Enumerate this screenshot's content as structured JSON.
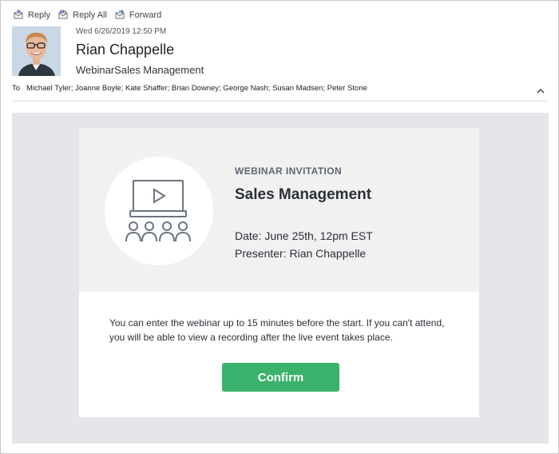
{
  "toolbar": {
    "reply_label": "Reply",
    "reply_all_label": "Reply All",
    "forward_label": "Forward"
  },
  "header": {
    "date": "Wed 6/26/2019 12:50 PM",
    "sender": "Rian Chappelle",
    "subject": "WebinarSales Management",
    "to_label": "To",
    "recipients": "Michael Tyler; Joanne Boyle; Kate Shaffer; Brian Downey; George Nash; Susan Madsen; Peter Stone"
  },
  "invitation": {
    "kicker": "WEBINAR INVITATION",
    "title": "Sales Management",
    "date_line": "Date: June 25th, 12pm EST",
    "presenter_line": "Presenter: Rian Chappelle",
    "description": "You can enter the webinar up to 15 minutes before the start. If you can't attend, you will be able to view a recording after the live event takes place.",
    "confirm_label": "Confirm"
  },
  "colors": {
    "confirm_button": "#3bb26b",
    "body_background": "#e4e6e9",
    "card_top_background": "#f1f1f2",
    "icon_stroke": "#6b7480",
    "toolbar_icon_accent": "#7a4fb3"
  }
}
